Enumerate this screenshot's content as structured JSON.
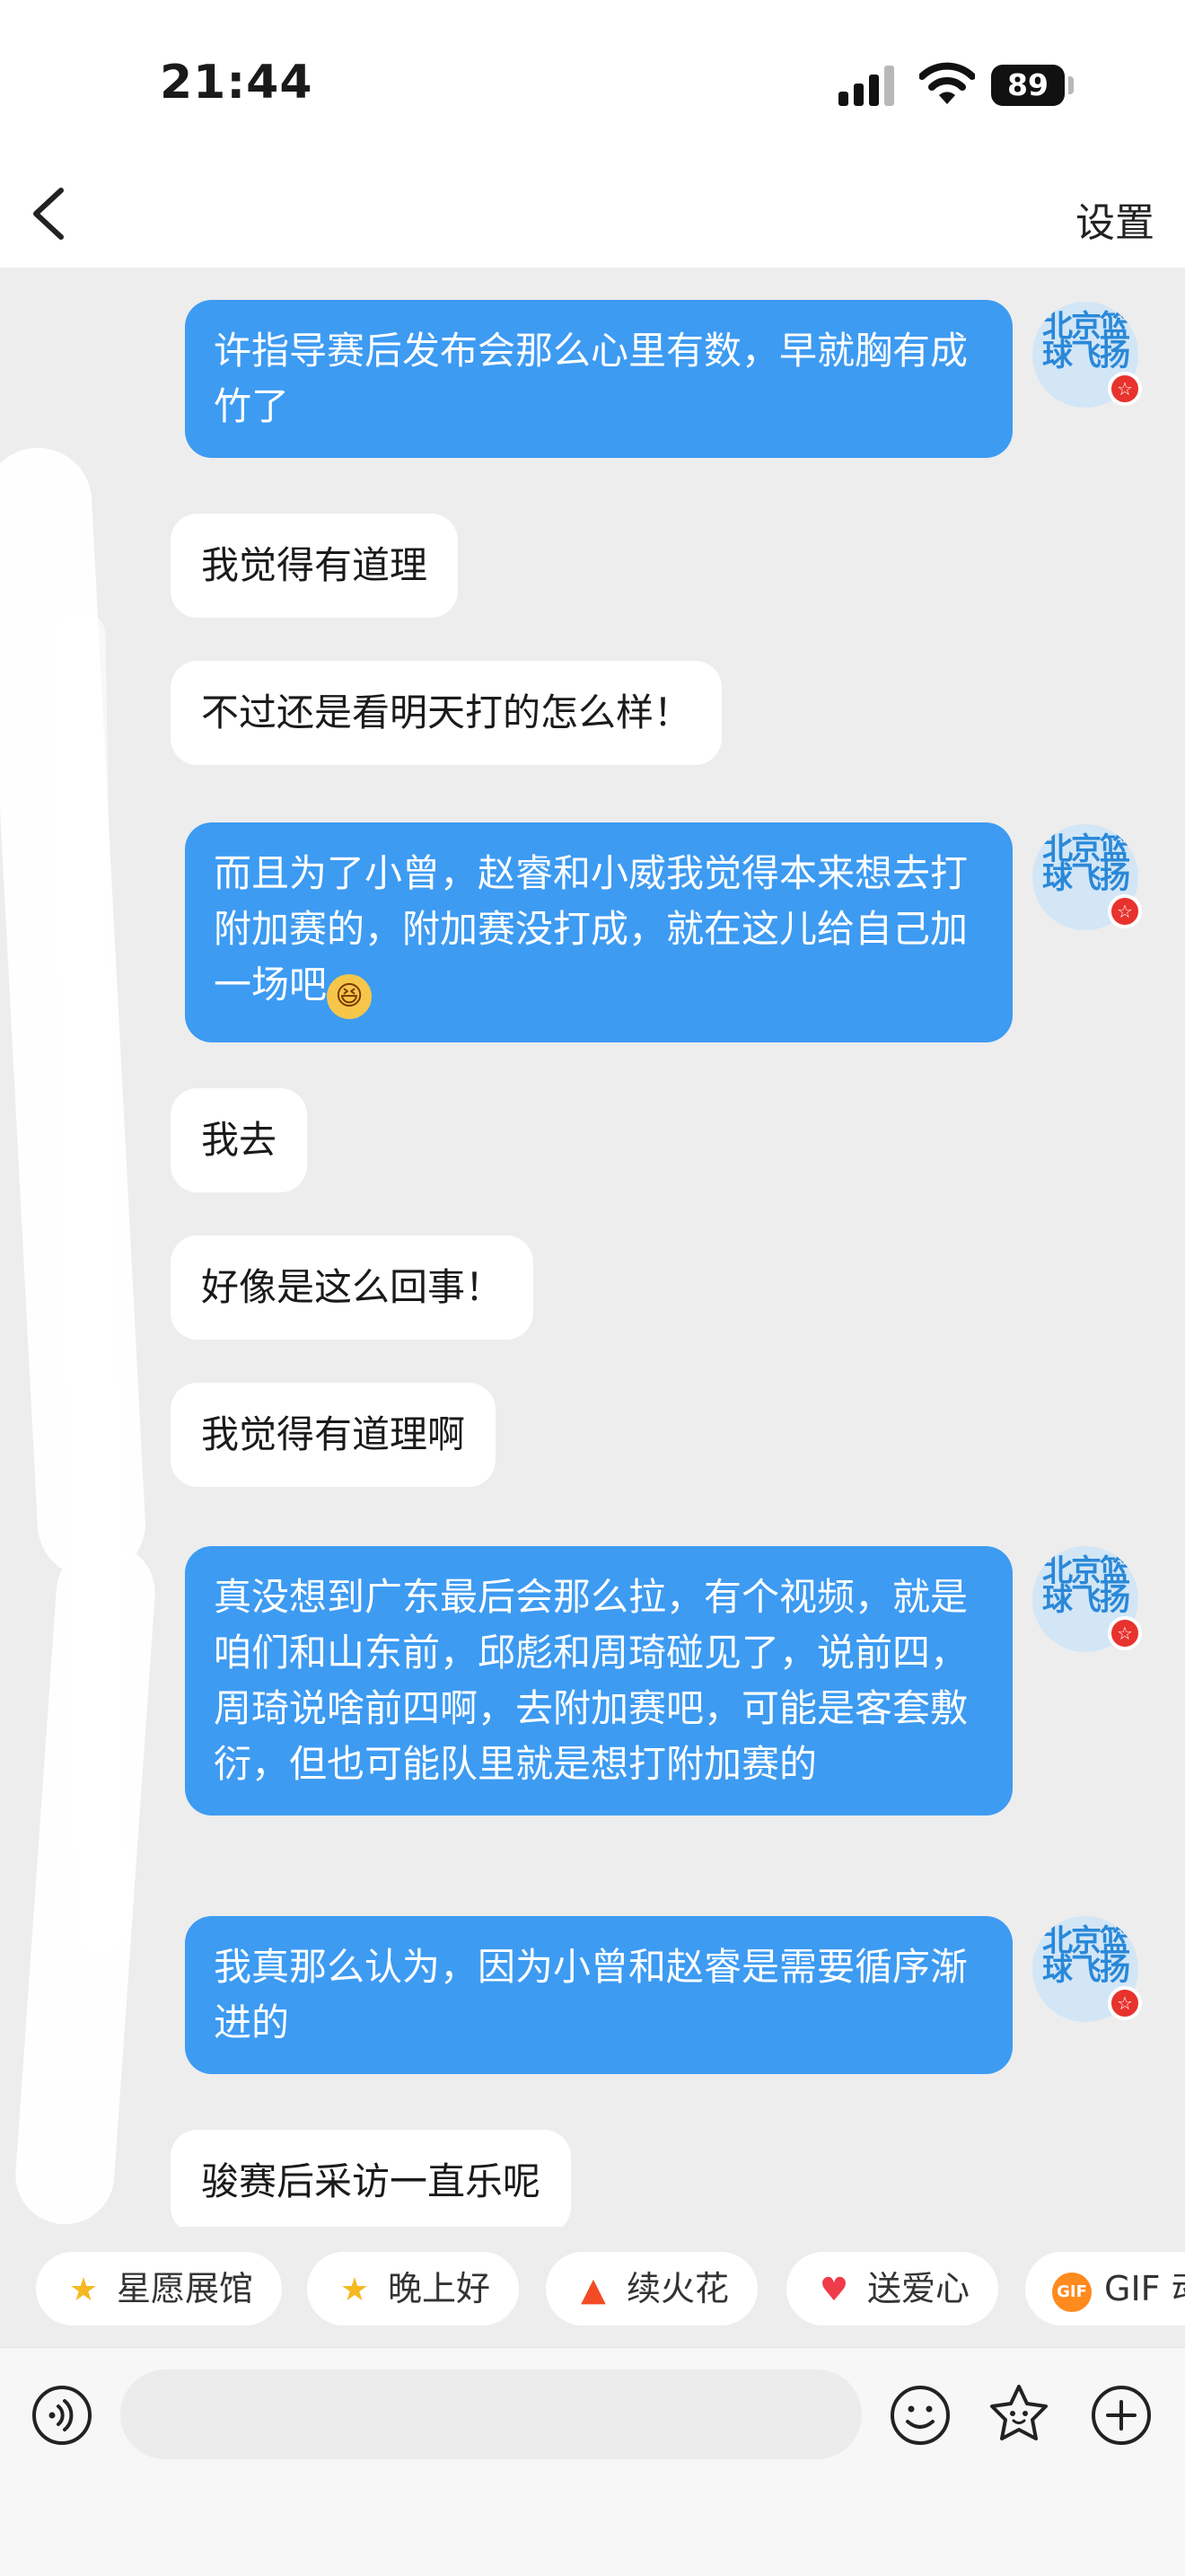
{
  "status_bar": {
    "time": "21:44",
    "battery": "89"
  },
  "nav": {
    "back_icon": "chevron-left-icon",
    "settings_label": "设置"
  },
  "messages": [
    {
      "side": "out",
      "text": "许指导赛后发布会那么心里有数，早就胸有成竹了"
    },
    {
      "side": "in",
      "text": "我觉得有道理"
    },
    {
      "side": "in",
      "text": "不过还是看明天打的怎么样！"
    },
    {
      "side": "out",
      "text": "而且为了小曾，赵睿和小威我觉得本来想去打附加赛的，附加赛没打成，就在这儿给自己加一场吧",
      "emoji": "laughing-face-emoji"
    },
    {
      "side": "in",
      "text": "我去"
    },
    {
      "side": "in",
      "text": "好像是这么回事！"
    },
    {
      "side": "in",
      "text": "我觉得有道理啊"
    },
    {
      "side": "out",
      "text": "真没想到广东最后会那么拉，有个视频，就是咱们和山东前，邱彪和周琦碰见了，说前四，周琦说啥前四啊，去附加赛吧，可能是客套敷衍，但也可能队里就是想打附加赛的"
    },
    {
      "side": "out",
      "text": "我真那么认为，因为小曾和赵睿是需要循序渐进的"
    },
    {
      "side": "in",
      "text": "骏赛后采访一直乐呢"
    }
  ],
  "avatar": {
    "glyphs": "北京篮球飞扬",
    "badge": "☆"
  },
  "quick_replies": [
    {
      "icon": "star-icon",
      "label": "星愿展馆"
    },
    {
      "icon": "star-face-icon",
      "label": "晚上好"
    },
    {
      "icon": "fire-icon",
      "label": "续火花"
    },
    {
      "icon": "heart-icon",
      "label": "送爱心"
    },
    {
      "icon": "gif-icon",
      "label": "GIF 动"
    }
  ],
  "input": {
    "placeholder": "",
    "voice_icon": "voice-icon",
    "emoji_icon": "emoji-icon",
    "sticker_icon": "sticker-icon",
    "plus_icon": "plus-icon"
  },
  "colors": {
    "outgoing_bubble": "#3d9bf2",
    "incoming_bubble": "#ffffff",
    "chat_background": "#ededed"
  }
}
